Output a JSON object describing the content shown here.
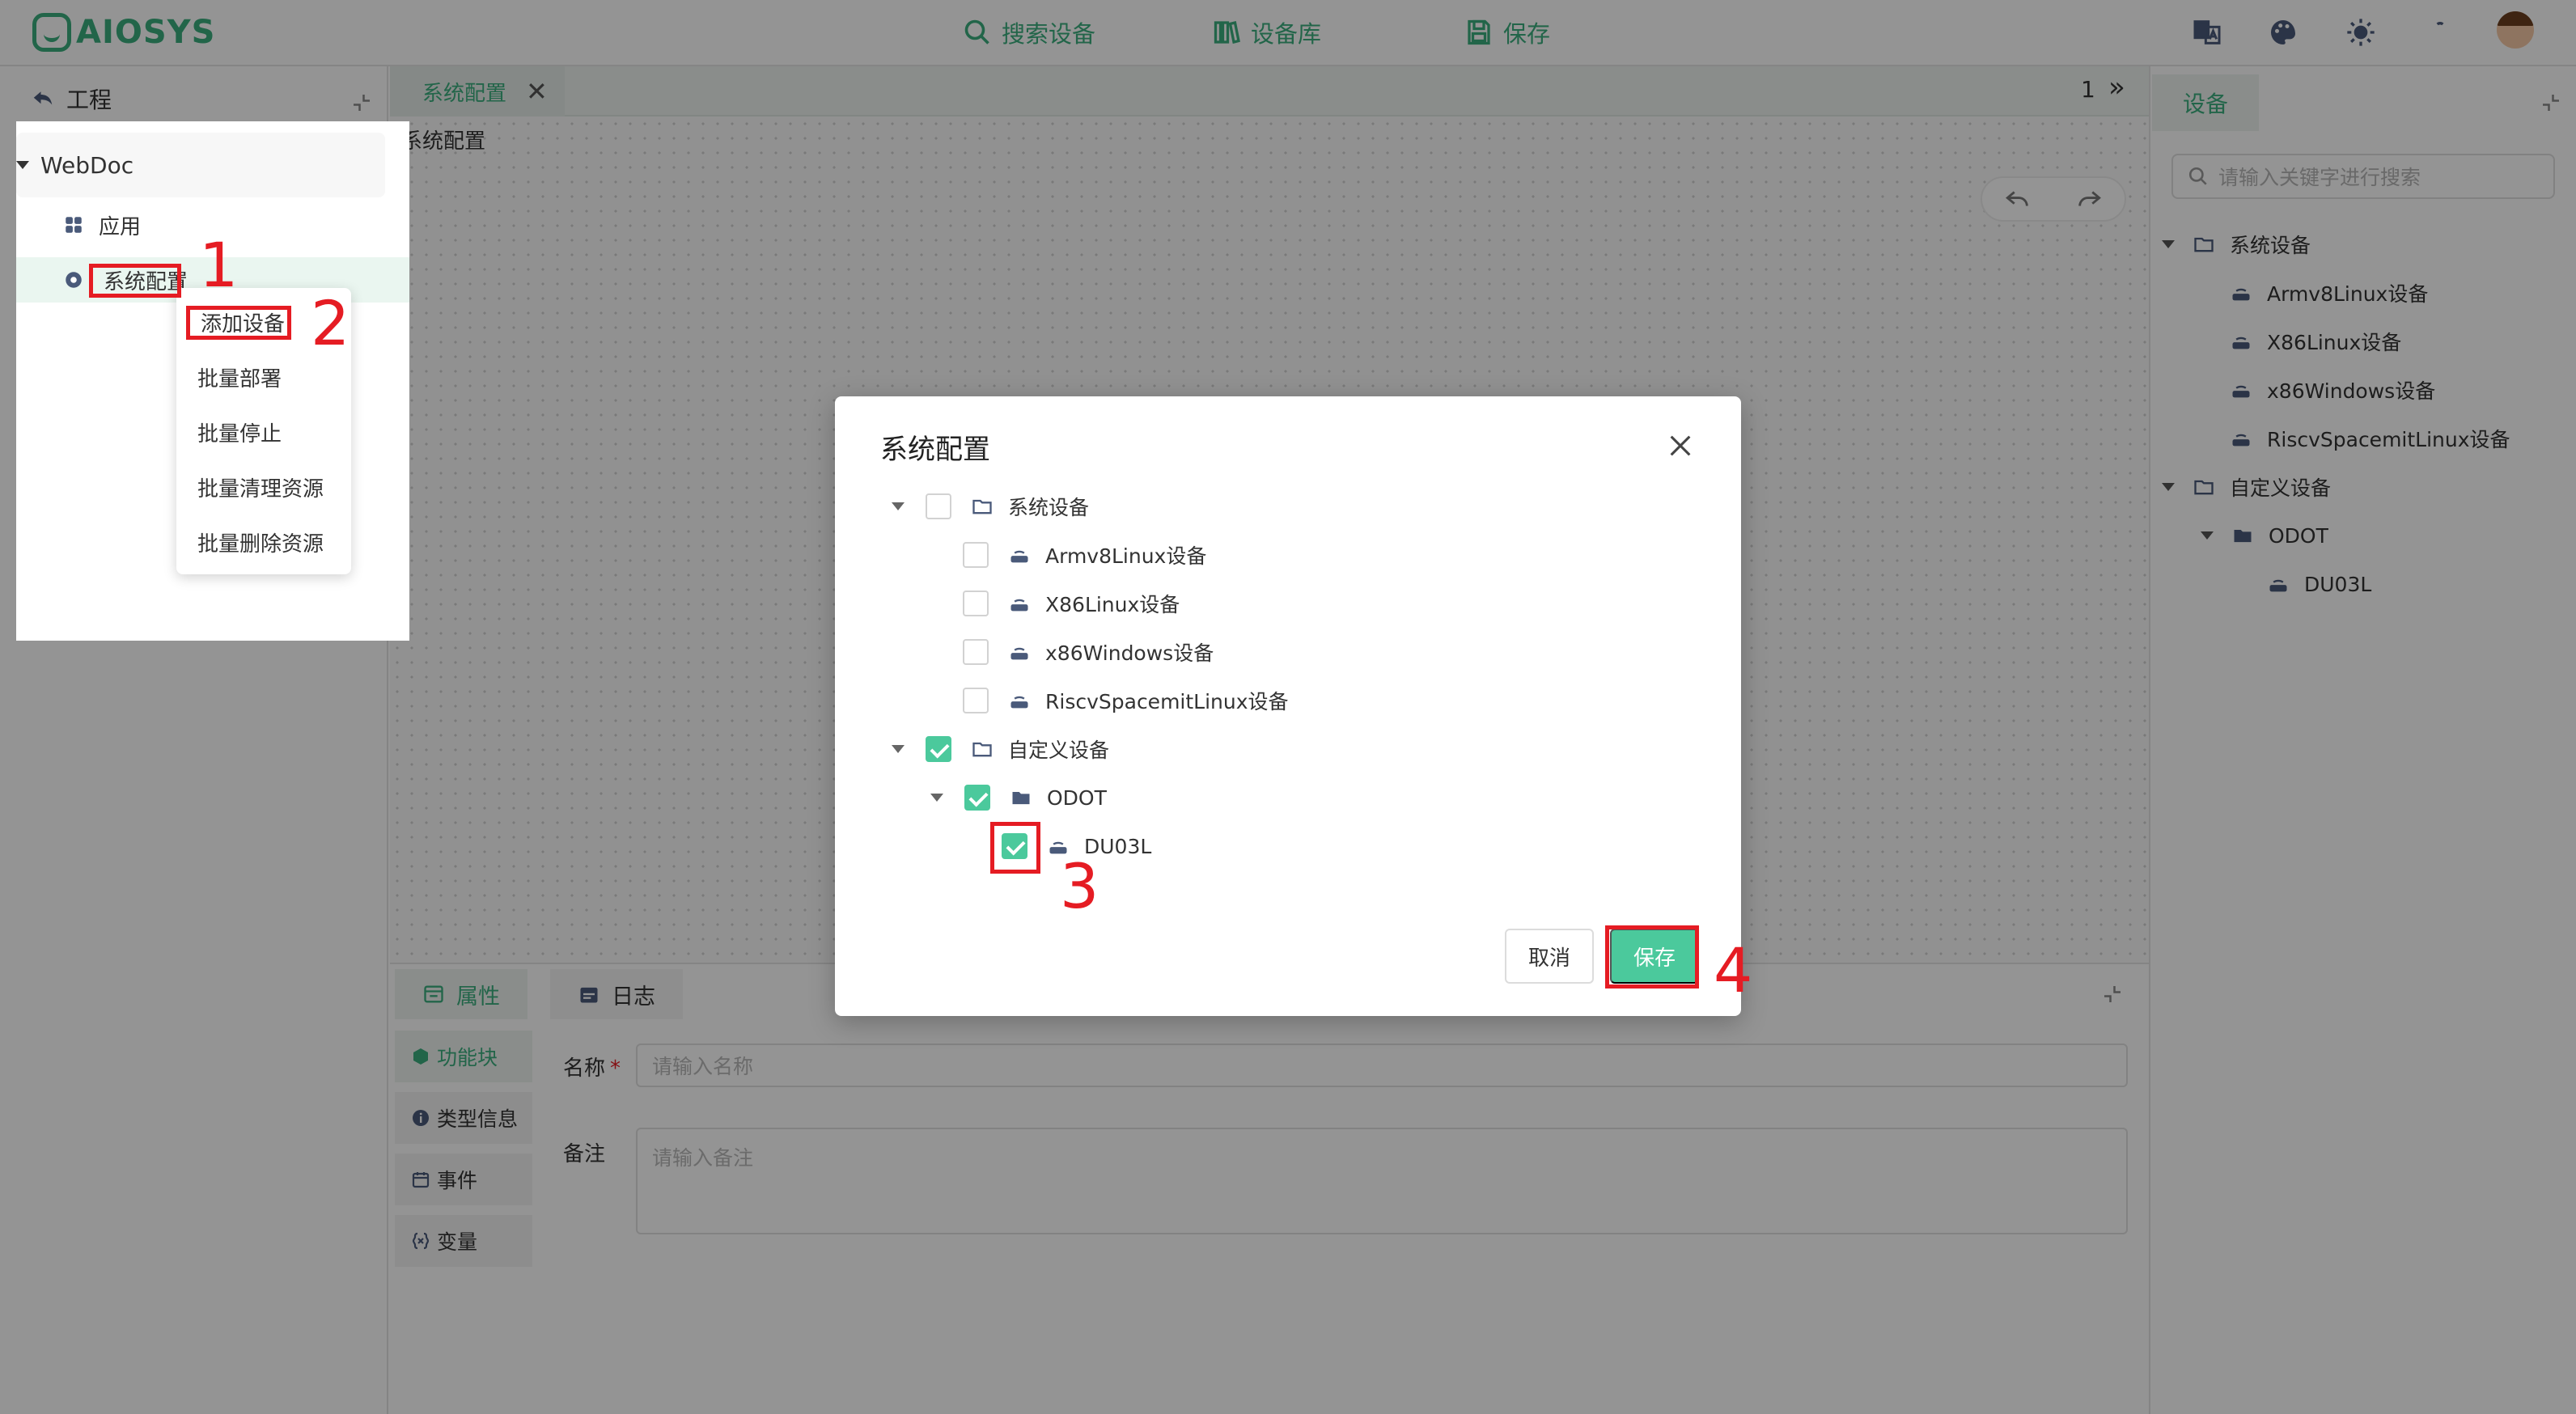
{
  "header": {
    "logo_text": "AIOSYS",
    "nav": {
      "search": "搜索设备",
      "library": "设备库",
      "save": "保存"
    }
  },
  "left_panel": {
    "title": "工程",
    "tree_root": "WebDoc",
    "items": [
      {
        "label": "应用"
      },
      {
        "label": "系统配置"
      }
    ],
    "context_menu": [
      "添加设备",
      "批量部署",
      "批量停止",
      "批量清理资源",
      "批量删除资源"
    ]
  },
  "center": {
    "tab_label": "系统配置",
    "tab_close": "✕",
    "tab_page": "1",
    "tab_more": "»",
    "canvas_title": "系统配置",
    "bottom_tabs": [
      "属性",
      "日志"
    ],
    "side_tabs": [
      "功能块",
      "类型信息",
      "事件",
      "变量"
    ],
    "form": {
      "name_label": "名称",
      "name_required": "*",
      "name_placeholder": "请输入名称",
      "note_label": "备注",
      "note_placeholder": "请输入备注"
    }
  },
  "right_panel": {
    "tab": "设备",
    "search_placeholder": "请输入关键字进行搜索",
    "groups": {
      "system": "系统设备",
      "system_items": [
        "Armv8Linux设备",
        "X86Linux设备",
        "x86Windows设备",
        "RiscvSpacemitLinux设备"
      ],
      "custom": "自定义设备",
      "folder": "ODOT",
      "device": "DU03L"
    }
  },
  "modal": {
    "title": "系统配置",
    "rows": {
      "system": "系统设备",
      "system_items": [
        "Armv8Linux设备",
        "X86Linux设备",
        "x86Windows设备",
        "RiscvSpacemitLinux设备"
      ],
      "custom": "自定义设备",
      "folder": "ODOT",
      "device": "DU03L"
    },
    "checked": {
      "system": false,
      "custom": true,
      "folder": true,
      "device": true
    },
    "cancel": "取消",
    "save": "保存"
  },
  "annotations": [
    "1",
    "2",
    "3",
    "4"
  ],
  "colors": {
    "accent": "#3cae7f",
    "checkbox": "#4bc99c",
    "annotation": "#e51c23"
  }
}
